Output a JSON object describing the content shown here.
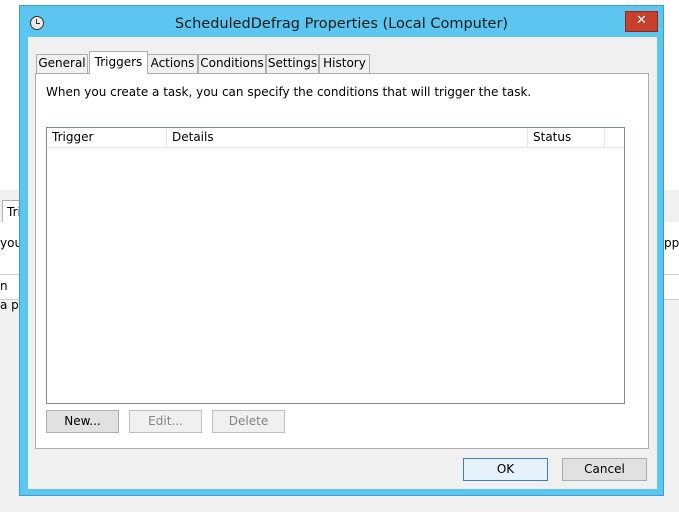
{
  "background": {
    "tab_fragment": "Tri",
    "text_left_1": "you",
    "text_left_2": "n",
    "text_left_3": "a pr",
    "text_right_1": "ppe"
  },
  "window": {
    "title": "ScheduledDefrag Properties (Local Computer)",
    "close_label": "✕"
  },
  "tabs": [
    {
      "label": "General"
    },
    {
      "label": "Triggers"
    },
    {
      "label": "Actions"
    },
    {
      "label": "Conditions"
    },
    {
      "label": "Settings"
    },
    {
      "label": "History"
    }
  ],
  "active_tab": "Triggers",
  "triggers": {
    "description": "When you create a task, you can specify the conditions that will trigger the task.",
    "columns": [
      "Trigger",
      "Details",
      "Status"
    ],
    "rows": [],
    "new_label": "New...",
    "edit_label": "Edit...",
    "delete_label": "Delete"
  },
  "footer": {
    "ok_label": "OK",
    "cancel_label": "Cancel"
  }
}
